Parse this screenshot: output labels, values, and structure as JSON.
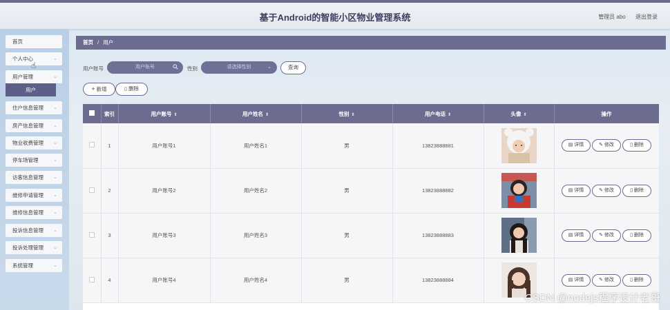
{
  "app": {
    "title": "基于Android的智能小区物业管理系统",
    "user_label": "管理员 abo",
    "logout": "退出登录"
  },
  "sidebar": {
    "items": [
      {
        "label": "首页",
        "chevron": false
      },
      {
        "label": "个人中心",
        "chevron": true
      },
      {
        "label": "用户管理",
        "chevron": true
      },
      {
        "label": "住户信息管理",
        "chevron": true
      },
      {
        "label": "房产信息管理",
        "chevron": true
      },
      {
        "label": "物业收费管理",
        "chevron": true
      },
      {
        "label": "停车场管理",
        "chevron": true
      },
      {
        "label": "访客信息管理",
        "chevron": true
      },
      {
        "label": "维修申请管理",
        "chevron": true
      },
      {
        "label": "维修信息管理",
        "chevron": true
      },
      {
        "label": "投诉信息管理",
        "chevron": true
      },
      {
        "label": "投诉处理管理",
        "chevron": true
      },
      {
        "label": "系统管理",
        "chevron": true
      }
    ],
    "active_sub": "用户"
  },
  "breadcrumb": {
    "home": "首页",
    "sep": "/",
    "current": "用户"
  },
  "search": {
    "account_label": "用户账号",
    "account_placeholder": "用户账号",
    "gender_label": "性别",
    "gender_placeholder": "请选择性别",
    "query_button": "查询"
  },
  "actions": {
    "add": "新增",
    "delete": "删除"
  },
  "table": {
    "columns": [
      "索引",
      "用户账号",
      "用户姓名",
      "性别",
      "用户电话",
      "头像",
      "操作"
    ],
    "rows": [
      {
        "index": "1",
        "account": "用户账号1",
        "name": "用户姓名1",
        "gender": "男",
        "phone": "13823888881"
      },
      {
        "index": "2",
        "account": "用户账号2",
        "name": "用户姓名2",
        "gender": "男",
        "phone": "13823888882"
      },
      {
        "index": "3",
        "account": "用户账号3",
        "name": "用户姓名3",
        "gender": "男",
        "phone": "13823888883"
      },
      {
        "index": "4",
        "account": "用户账号4",
        "name": "用户姓名4",
        "gender": "男",
        "phone": "13823888884"
      }
    ],
    "ops": {
      "detail": "详情",
      "edit": "修改",
      "delete": "删除"
    }
  },
  "colors": {
    "primary": "#6b6c90",
    "sidebar": "#c0d4e8"
  },
  "watermark": "CSDN @nodejs程序设计老哥"
}
